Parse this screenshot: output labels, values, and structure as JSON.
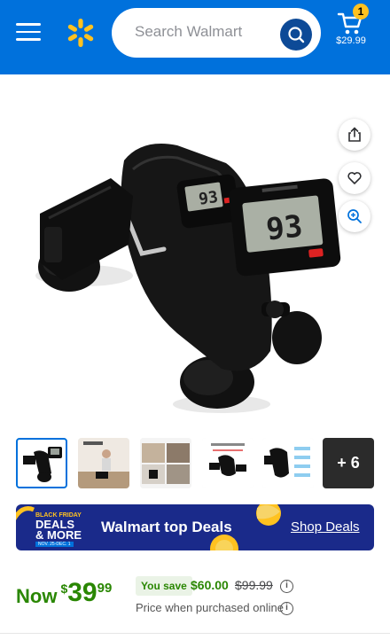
{
  "header": {
    "search_placeholder": "Search Walmart",
    "cart_count": "1",
    "cart_total": "$29.99",
    "brand_color": "#0071dc",
    "accent_color": "#ffc220",
    "icons": {
      "menu": "hamburger-menu-icon",
      "logo": "walmart-spark-icon",
      "search": "search-icon",
      "cart": "cart-icon"
    }
  },
  "product_image": {
    "display_readout": "93",
    "icons": [
      "share-icon",
      "heart-icon",
      "zoom-in-icon"
    ]
  },
  "thumbnails": {
    "more_label": "+ 6"
  },
  "banner": {
    "badge_line1": "BLACK FRIDAY",
    "badge_line2": "DEALS",
    "badge_line3": "& MORE",
    "badge_line4": "NOV. 25-DEC. 1",
    "title": "Walmart top Deals",
    "link": "Shop Deals"
  },
  "price": {
    "now_label": "Now",
    "currency": "$",
    "whole": "39",
    "cents": "99",
    "save_label": "You save",
    "save_amount": "$60.00",
    "was_price": "$99.99",
    "price_note": "Price when purchased online",
    "price_color": "#2a8703"
  }
}
